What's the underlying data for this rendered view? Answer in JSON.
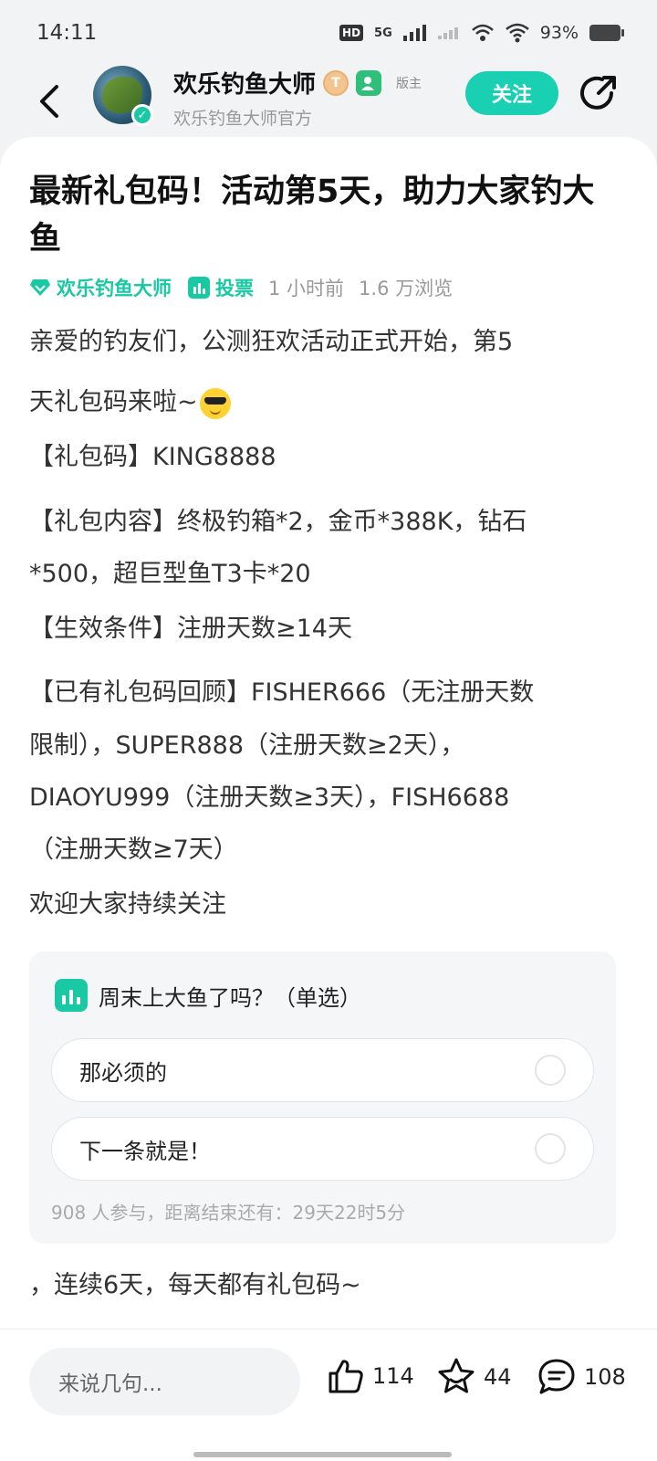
{
  "status_bar": {
    "time": "14:11",
    "hd_label": "HD",
    "network": "5G",
    "battery": "93%"
  },
  "header": {
    "name": "欢乐钓鱼大师",
    "subtitle": "欢乐钓鱼大师官方",
    "level_badge": "T",
    "mod_label": "版主",
    "follow_label": "关注"
  },
  "post": {
    "title": "最新礼包码！活动第5天，助力大家钓大鱼",
    "meta": {
      "forum": "欢乐钓鱼大师",
      "type": "投票",
      "time": "1 小时前",
      "views": "1.6 万浏览"
    },
    "lines": {
      "l1": "亲爱的钓友们，公测狂欢活动正式开始，第5",
      "l2": "天礼包码来啦~",
      "l3": "【礼包码】KING8888",
      "l4": "【礼包内容】终极钓箱*2，金币*388K，钻石",
      "l5": "*500，超巨型鱼T3卡*20",
      "l6": "【生效条件】注册天数≥14天",
      "l7": "【已有礼包码回顾】FISHER666（无注册天数",
      "l8": "限制），SUPER888（注册天数≥2天），",
      "l9": "DIAOYU999（注册天数≥3天），FISH6688",
      "l10": "（注册天数≥7天）",
      "l11": "欢迎大家持续关注"
    },
    "tail": "，连续6天，每天都有礼包码~"
  },
  "poll": {
    "question": "周末上大鱼了吗？（单选）",
    "options": [
      "那必须的",
      "下一条就是！"
    ],
    "footer": "908 人参与，距离结束还有：29天22时5分"
  },
  "bottom": {
    "input_placeholder": "来说几句...",
    "likes": "114",
    "favorites": "44",
    "comments": "108"
  },
  "colors": {
    "accent": "#19d0b3",
    "background": "#f2f3f5"
  }
}
